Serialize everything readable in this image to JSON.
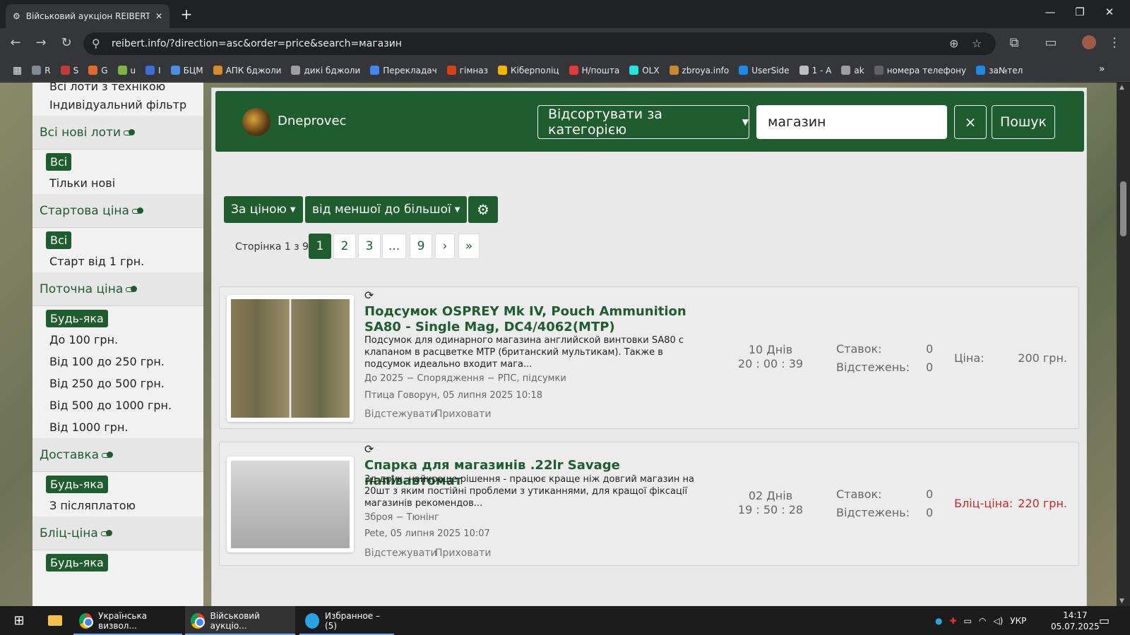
{
  "browser": {
    "tab_title": "Військовий аукціон REIBERT | Г",
    "url": "reibert.info/?direction=asc&order=price&search=магазин",
    "bookmarks": [
      {
        "label": "R",
        "color": "#7e8a99"
      },
      {
        "label": "S",
        "color": "#c23b3b"
      },
      {
        "label": "G",
        "color": "#e06a2a"
      },
      {
        "label": "u",
        "color": "#7cb342"
      },
      {
        "label": "I",
        "color": "#3b6fd6"
      },
      {
        "label": "БЦМ",
        "color": "#4a90e2"
      },
      {
        "label": "АПК бджоли",
        "color": "#d68a2a"
      },
      {
        "label": "дикі бджоли",
        "color": "#9e9e9e"
      },
      {
        "label": "Перекладач",
        "color": "#4285f4"
      },
      {
        "label": "гімназ",
        "color": "#d84315"
      },
      {
        "label": "Кіберполіц",
        "color": "#f4b400"
      },
      {
        "label": "Н/пошта",
        "color": "#e53935"
      },
      {
        "label": "OLX",
        "color": "#23e5db"
      },
      {
        "label": "zbroya.info",
        "color": "#c68a2e"
      },
      {
        "label": "UserSide",
        "color": "#1e88e5"
      },
      {
        "label": "1 - A",
        "color": "#bdbdbd"
      },
      {
        "label": "ak",
        "color": "#9e9e9e"
      },
      {
        "label": "номера телефону",
        "color": "#616161"
      },
      {
        "label": "за№тел",
        "color": "#1e88e5"
      }
    ]
  },
  "sidebar": {
    "top_items": [
      "Всі лоти з технікою",
      "Індивідуальний фільтр"
    ],
    "sections": [
      {
        "title": "Всі нові лоти",
        "selected": "Всі",
        "items": [
          "Тільки нові"
        ]
      },
      {
        "title": "Стартова ціна",
        "selected": "Всі",
        "items": [
          "Старт від 1 грн."
        ]
      },
      {
        "title": "Поточна ціна",
        "selected": "Будь-яка",
        "items": [
          "До 100 грн.",
          "Від 100 до 250 грн.",
          "Від 250 до 500 грн.",
          "Від 500 до 1000 грн.",
          "Від 1000 грн."
        ]
      },
      {
        "title": "Доставка",
        "selected": "Будь-яка",
        "items": [
          "З післяплатою"
        ]
      },
      {
        "title": "Бліц-ціна",
        "selected": "Будь-яка",
        "items": []
      }
    ]
  },
  "header": {
    "username": "Dneprovec",
    "category_button": "Відсортувати за категорією",
    "search_value": "магазин",
    "clear_label": "×",
    "search_button": "Пошук"
  },
  "sort": {
    "by": "За ціною",
    "direction": "від меншої до більшої"
  },
  "pagination": {
    "label": "Сторінка 1 з 9",
    "pages": [
      "1",
      "2",
      "3",
      "...",
      "9",
      "›",
      "»"
    ],
    "current": "1"
  },
  "lots": [
    {
      "title": "Подсумок OSPREY Mk IV, Pouch Ammunition SA80 - Single Mag, DC4/4062(MTP)",
      "description": "Подсумок для одинарного магазина английской винтовки SA80 с клапаном в расцветке MTP (британский мультикам). Также в подсумок идеально входит мага...",
      "category": "До 2025 − Спорядження − РПС, підсумки",
      "author": "Птица Говорун, 05 липня 2025 10:18",
      "timer_days": "10 Днів",
      "timer_time": "20 : 00 : 39",
      "bids_label": "Ставок:",
      "bids": "0",
      "watch_label": "Відстежень:",
      "watch": "0",
      "price_label": "Ціна:",
      "price": "200 грн.",
      "price_color": "#666666",
      "watch_action": "Відстежувати",
      "hide_action": "Приховати"
    },
    {
      "title": "Спарка для магазинів .22lr Savage напівавтомат",
      "description": "3д друк, найкраще рішення - працює краще ніж довгий магазин на 20шт з яким постійні проблеми з утиканнями, для кращої фіксації магазинів рекомендов...",
      "category": "Зброя − Тюнінг",
      "author": "Pete, 05 липня 2025 10:07",
      "timer_days": "02 Днів",
      "timer_time": "19 : 50 : 28",
      "bids_label": "Ставок:",
      "bids": "0",
      "watch_label": "Відстежень:",
      "watch": "0",
      "price_label": "Бліц-ціна:",
      "price": "220 грн.",
      "price_color": "#c62828",
      "watch_action": "Відстежувати",
      "hide_action": "Приховати"
    }
  ],
  "taskbar": {
    "apps": [
      {
        "label": "Українська визвол..."
      },
      {
        "label": "Військовий аукціо..."
      },
      {
        "label": "Избранное – (5)"
      }
    ],
    "lang": "УКР",
    "time": "14:17",
    "date": "05.07.2025"
  },
  "colors": {
    "accent": "#1f5c2e",
    "blitz": "#c62828"
  }
}
